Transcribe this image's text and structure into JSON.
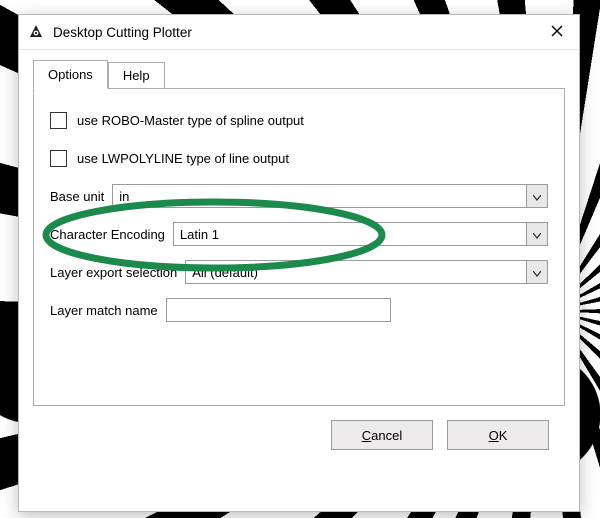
{
  "window": {
    "title": "Desktop Cutting Plotter"
  },
  "tabs": {
    "options": "Options",
    "help": "Help"
  },
  "options": {
    "robo_checkbox_label": "use ROBO-Master type of spline output",
    "lwpoly_checkbox_label": "use LWPOLYLINE type of line output",
    "base_unit_label": "Base unit",
    "base_unit_value": "in",
    "char_encoding_label": "Character Encoding",
    "char_encoding_value": "Latin 1",
    "layer_export_label": "Layer export selection",
    "layer_export_value": "All (default)",
    "layer_match_label": "Layer match name",
    "layer_match_value": ""
  },
  "buttons": {
    "cancel_pre": "",
    "cancel_mn": "C",
    "cancel_post": "ancel",
    "ok_pre": "",
    "ok_mn": "O",
    "ok_post": "K"
  },
  "colors": {
    "annotation": "#1b8a4c"
  }
}
